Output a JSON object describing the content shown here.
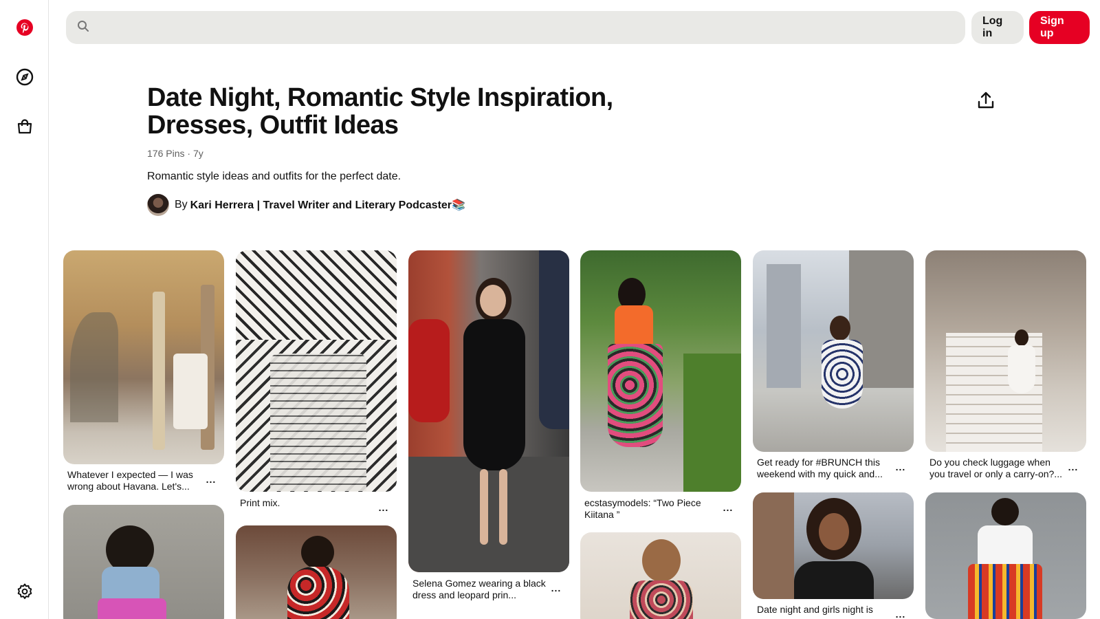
{
  "rail": {
    "items": [
      {
        "name": "pinterest-logo-icon"
      },
      {
        "name": "explore-compass-icon"
      },
      {
        "name": "shop-bag-icon"
      },
      {
        "name": "settings-gear-icon"
      }
    ],
    "brand_color": "#e60023"
  },
  "header": {
    "search_placeholder": "",
    "login_label": "Log in",
    "signup_label": "Sign up"
  },
  "board": {
    "title": "Date Night, Romantic Style Inspiration, Dresses, Outfit Ideas",
    "pins_count": "176 Pins",
    "age": "7y",
    "description": "Romantic style ideas and outfits for the perfect date.",
    "by_prefix": "By",
    "author": "Kari Herrera | Travel Writer and Literary Podcaster📚"
  },
  "pins": [
    {
      "caption": "Whatever I expected — I was wrong about Havana.  Let's...",
      "more": "..."
    },
    {
      "caption": "Print mix.",
      "more": "..."
    },
    {
      "caption": "Selena Gomez wearing a black dress and leopard prin...",
      "more": "..."
    },
    {
      "caption": "ecstasymodels: “Two Piece Kiitana ”",
      "more": "..."
    },
    {
      "caption": "Get ready for #BRUNCH this weekend with my quick and...",
      "more": "..."
    },
    {
      "caption": "Do you check luggage when you travel or only a carry-on?...",
      "more": "..."
    },
    {
      "caption": "",
      "more": ""
    },
    {
      "caption": "",
      "more": ""
    },
    {
      "caption": "",
      "more": ""
    },
    {
      "caption": "Date night and girls night is",
      "more": "..."
    },
    {
      "caption": "",
      "more": ""
    }
  ]
}
